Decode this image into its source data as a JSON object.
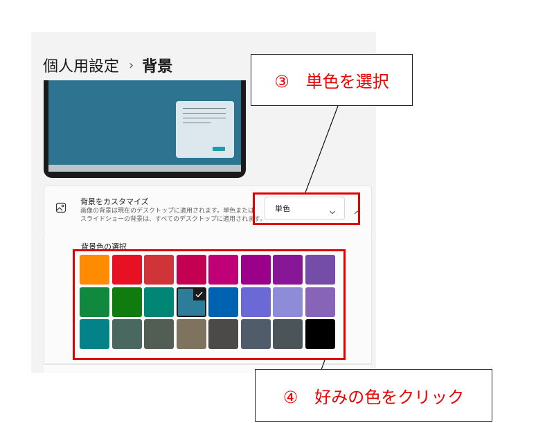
{
  "breadcrumb": {
    "parent": "個人用設定",
    "separator": "›",
    "current": "背景"
  },
  "customize": {
    "title": "背景をカスタマイズ",
    "desc_line1": "画像の背景は現在のデスクトップに適用されます。単色または",
    "desc_line2": "スライドショーの背景は、すべてのデスクトップに適用されます。",
    "dropdown_value": "単色",
    "icon": "image-icon"
  },
  "colors": {
    "section_title": "背景色の選択",
    "swatches": [
      "#ff8c00",
      "#e81123",
      "#d13438",
      "#c30052",
      "#bf0077",
      "#9a0089",
      "#881798",
      "#744da9",
      "#10893e",
      "#107c10",
      "#018574",
      "#2d7d9a",
      "#0063b1",
      "#6b69d6",
      "#8e8cd8",
      "#8764b8",
      "#038387",
      "#486860",
      "#525e54",
      "#7e735f",
      "#4c4a48",
      "#515c6b",
      "#4a5459",
      "#000000"
    ],
    "selected_index": 11
  },
  "annotations": {
    "step3": "③　単色を選択",
    "step4": "④　好みの色をクリック",
    "highlight_color": "#e00000"
  }
}
